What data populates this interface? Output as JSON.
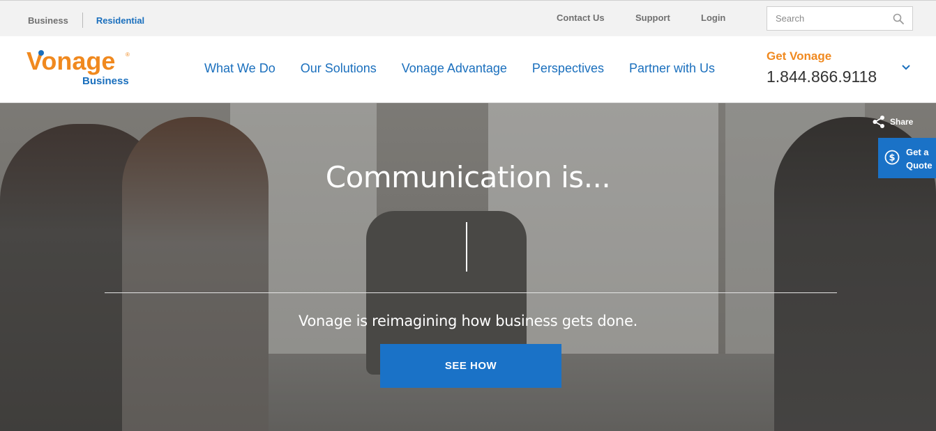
{
  "utility": {
    "business_label": "Business",
    "residential_label": "Residential",
    "contact_label": "Contact Us",
    "support_label": "Support",
    "login_label": "Login",
    "search_placeholder": "Search"
  },
  "brand": {
    "logo_word": "Vonage",
    "logo_sub": "Business",
    "logo_reg": "®",
    "orange": "#f0891f",
    "blue": "#1a6fbd"
  },
  "nav": {
    "items": [
      {
        "label": "What We Do"
      },
      {
        "label": "Our Solutions"
      },
      {
        "label": "Vonage Advantage"
      },
      {
        "label": "Perspectives"
      },
      {
        "label": "Partner with Us"
      }
    ],
    "get_vonage_label": "Get Vonage",
    "phone": "1.844.866.9118"
  },
  "hero": {
    "title": "Communication is...",
    "subtitle": "Vonage is reimagining how business gets done.",
    "cta_label": "SEE HOW",
    "share_label": "Share",
    "quote_line1": "Get a",
    "quote_line2": "Quote"
  },
  "icons": {
    "search": "search-icon",
    "chevron": "chevron-down-icon",
    "share": "share-icon",
    "quote": "dollar-circle-icon"
  }
}
